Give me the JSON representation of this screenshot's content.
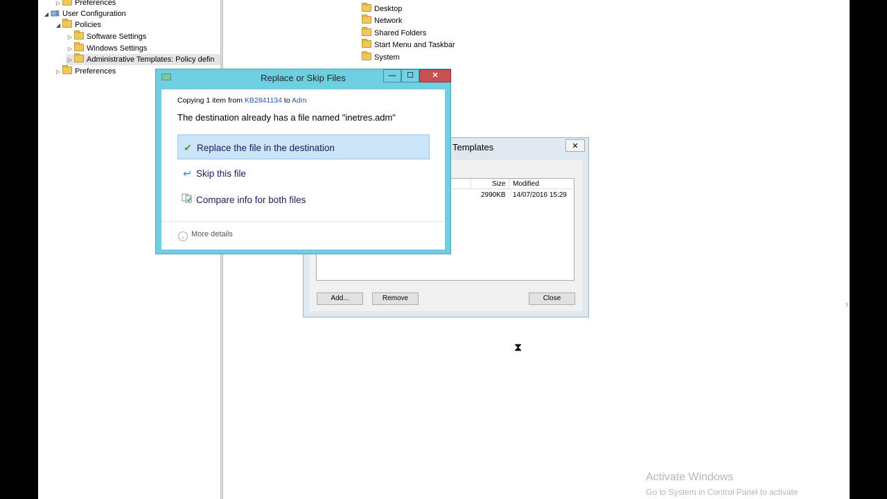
{
  "tree": {
    "items": [
      {
        "label": "Preferences",
        "arrow": "▷"
      },
      {
        "label": "User Configuration",
        "arrow": "◢"
      },
      {
        "label": "Policies",
        "arrow": "◢"
      },
      {
        "label": "Software Settings",
        "arrow": "▷"
      },
      {
        "label": "Windows Settings",
        "arrow": "▷"
      },
      {
        "label": "Administrative Templates: Policy defin",
        "arrow": "▷"
      },
      {
        "label": "Preferences",
        "arrow": "▷"
      }
    ]
  },
  "right_list": {
    "items": [
      "Desktop",
      "Network",
      "Shared Folders",
      "Start Menu and Taskbar",
      "System"
    ]
  },
  "background_dialog": {
    "title": "Templates",
    "close_label": "✕",
    "columns": {
      "size": "Size",
      "modified": "Modified"
    },
    "row": {
      "size": "2990KB",
      "modified": "14/07/2016 15:29"
    },
    "buttons": {
      "add": "Add...",
      "remove": "Remove",
      "close": "Close"
    }
  },
  "dialog": {
    "title": "Replace or Skip Files",
    "copy_prefix": "Copying 1 item from ",
    "source": "KB2841134",
    "copy_to": " to ",
    "destination": "Adm",
    "message": "The destination already has a file named \"inetres.adm\"",
    "options": {
      "replace": "Replace the file in the destination",
      "skip": "Skip this file",
      "compare": "Compare info for both files"
    },
    "more_details": "More details",
    "window_buttons": {
      "minimize": "—",
      "maximize": "☐",
      "close": "✕"
    }
  },
  "watermark": {
    "line1": "Activate Windows",
    "line2": "Go to System in Control Panel to activate"
  },
  "colors": {
    "dialog_frame": "#6fcfe0",
    "selection": "#cce4f7",
    "close_button": "#c75050",
    "link": "#1e5fb4"
  }
}
